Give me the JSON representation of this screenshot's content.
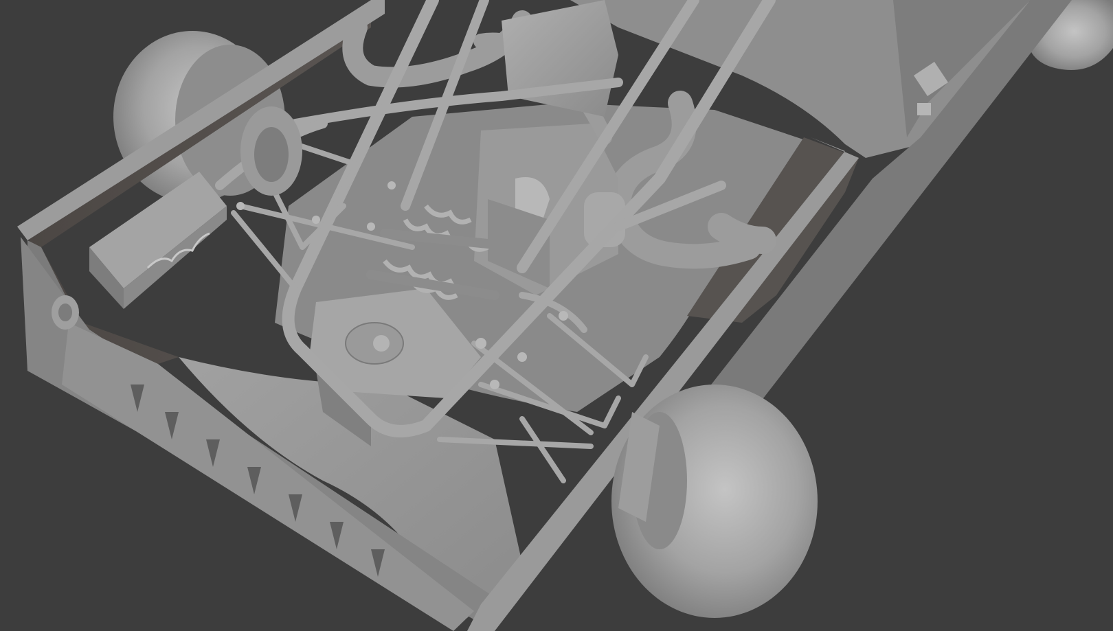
{
  "viewport": {
    "background": "#3d3d3d",
    "shading": "solid-matcap-grey"
  },
  "model": {
    "body_color": "#8f8f8f",
    "body_shadow": "#4a4643",
    "tube_color": "#9a9a9a",
    "tire_color": "#a3a3a3"
  },
  "icons": {
    "logo_glyph": "scribble-logo-icon"
  }
}
